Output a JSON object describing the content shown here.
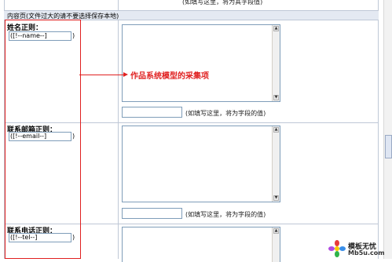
{
  "top_hint": "(如填写这里，将为其字段值)",
  "section_title": "内容页(文件过大的请不要选择保存本地)",
  "annotation": "作品系统模型的采集项",
  "rows": [
    {
      "label": "姓名正则：",
      "field_value": "([!--name--]",
      "field_suffix": ")",
      "hint": "(如填写这里，将为字段的值)"
    },
    {
      "label": "联系邮箱正则：",
      "field_value": "([!--email--]",
      "field_suffix": ")",
      "hint": "(如填写这里，将为字段的值)"
    },
    {
      "label": "联系电话正则：",
      "field_value": "([!--tel--]",
      "field_suffix": ")",
      "hint": ""
    }
  ],
  "watermark": {
    "line1": "模板无忧",
    "line2": "Mb5u.com"
  },
  "colors": {
    "border": "#bfc8d6",
    "section_bg": "#e4e9f2",
    "red": "#e02020"
  }
}
